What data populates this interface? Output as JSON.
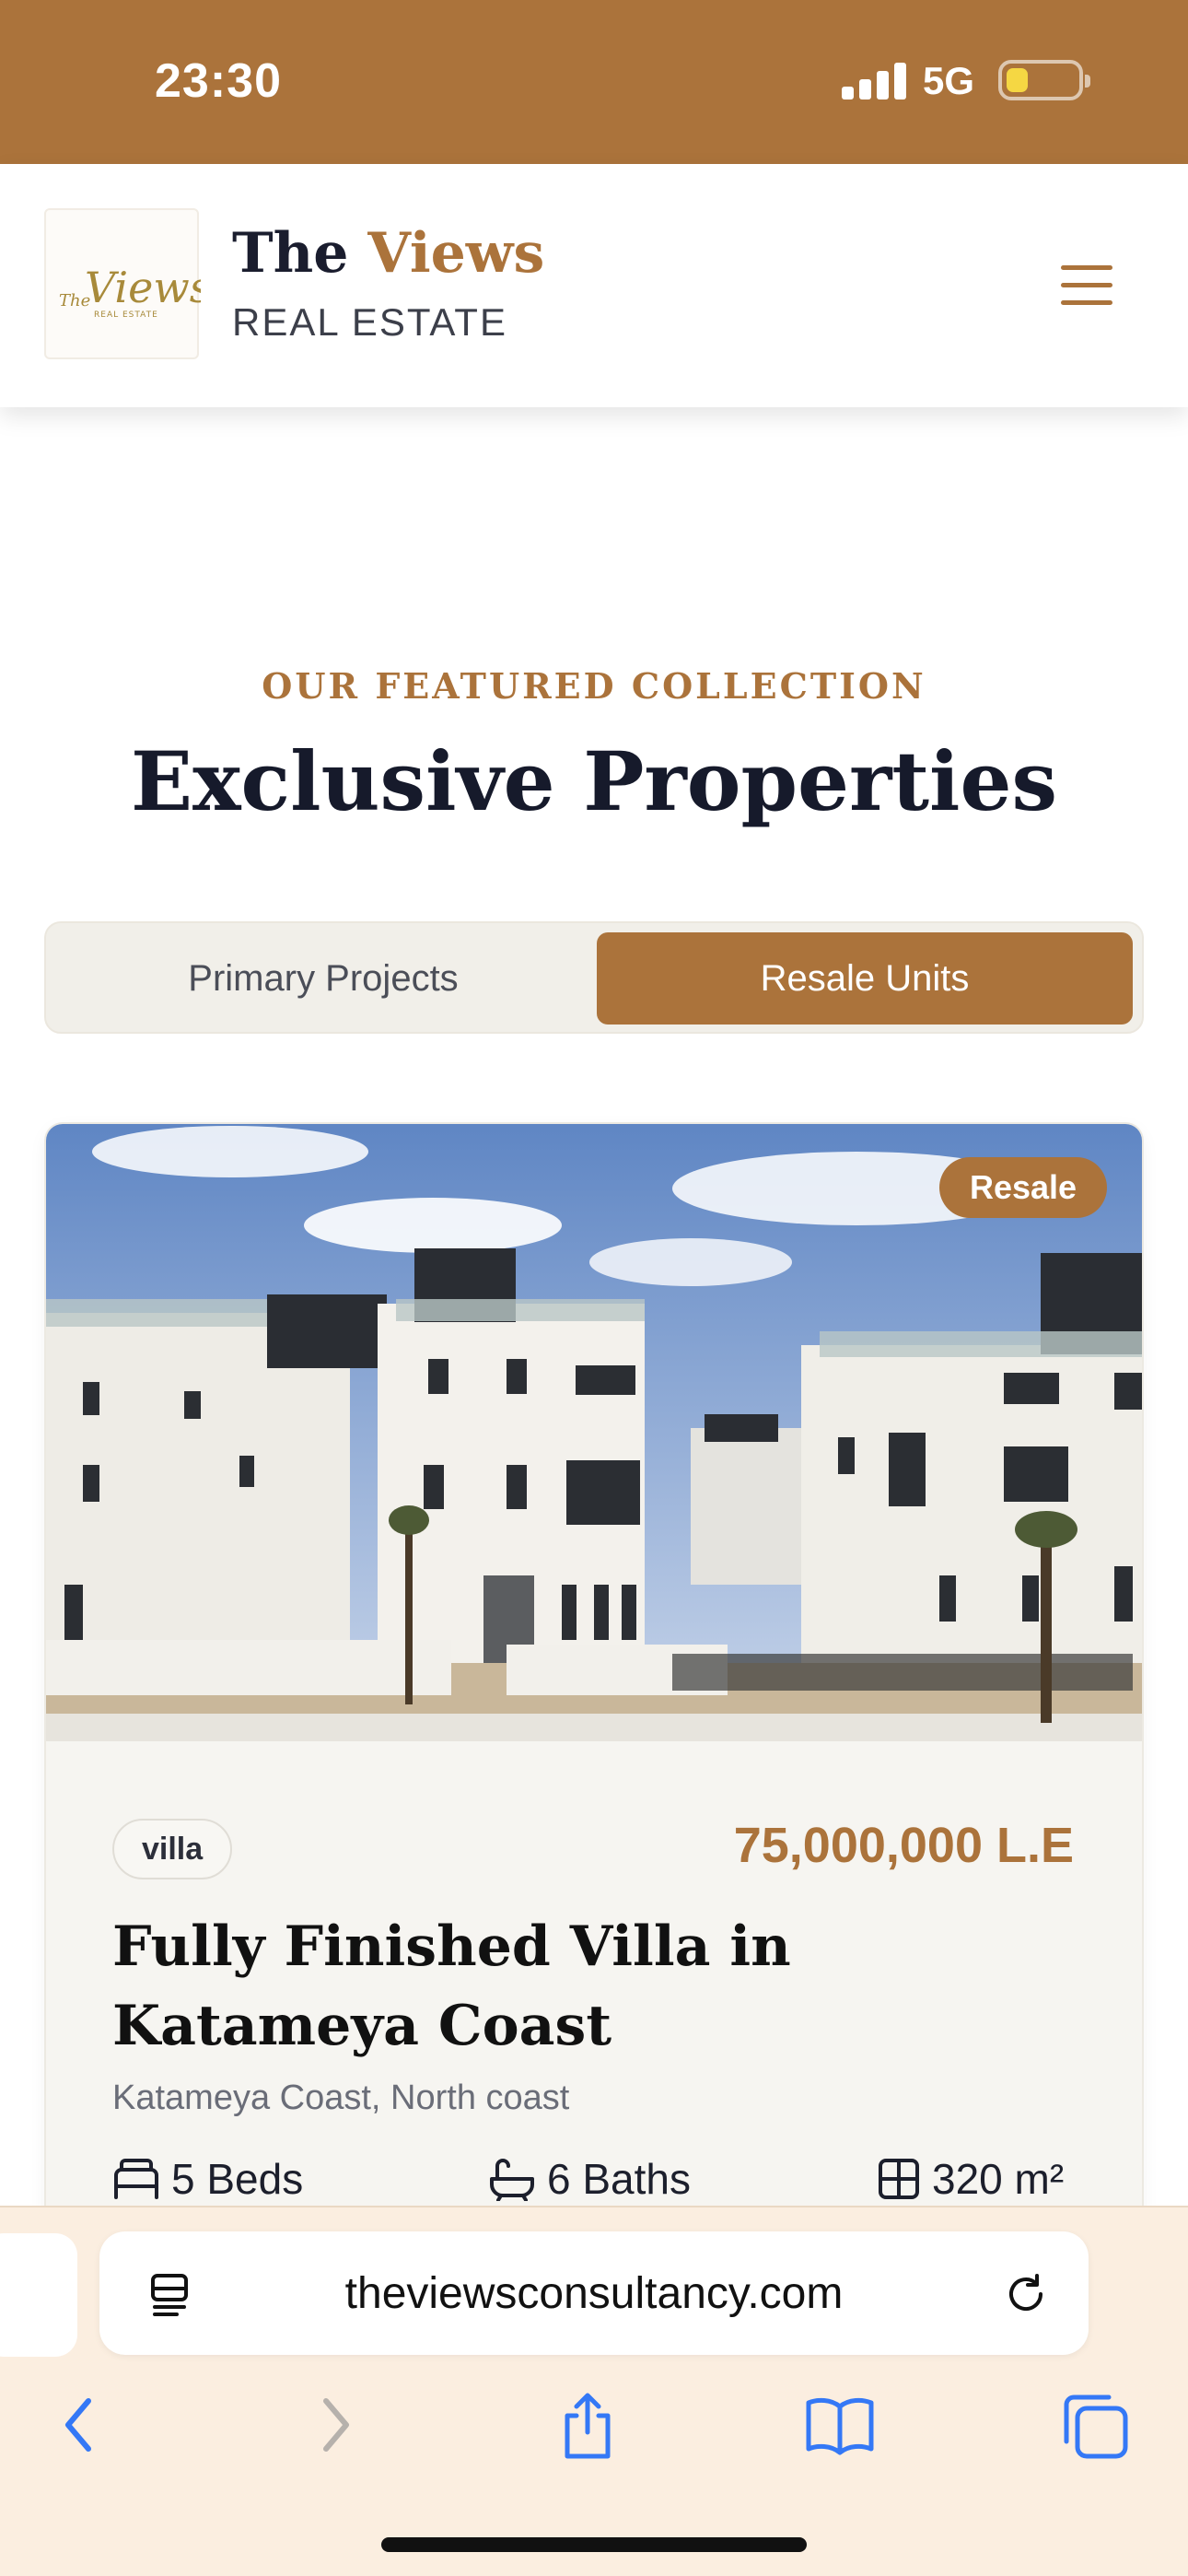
{
  "status_bar": {
    "time": "23:30",
    "network": "5G",
    "battery_level": 0.3
  },
  "header": {
    "brand_title_prefix": "The",
    "brand_title_accent": "Views",
    "brand_subtitle": "REAL ESTATE",
    "logo_text": "The Views",
    "logo_subtext": "REAL ESTATE"
  },
  "section": {
    "eyebrow": "OUR FEATURED COLLECTION",
    "title": "Exclusive Properties"
  },
  "tabs": {
    "primary_label": "Primary Projects",
    "resale_label": "Resale Units",
    "active": "Resale Units"
  },
  "listing": {
    "badge": "Resale",
    "type": "villa",
    "price": "75,000,000 L.E",
    "title": "Fully Finished Villa in Katameya Coast",
    "location": "Katameya Coast, North coast",
    "beds": "5 Beds",
    "baths": "6 Baths",
    "area": "320 m²"
  },
  "browser": {
    "url": "theviewsconsultancy.com"
  },
  "colors": {
    "accent": "#ab733b",
    "dark": "#161a2b",
    "browser_bg": "#fbeee0"
  }
}
